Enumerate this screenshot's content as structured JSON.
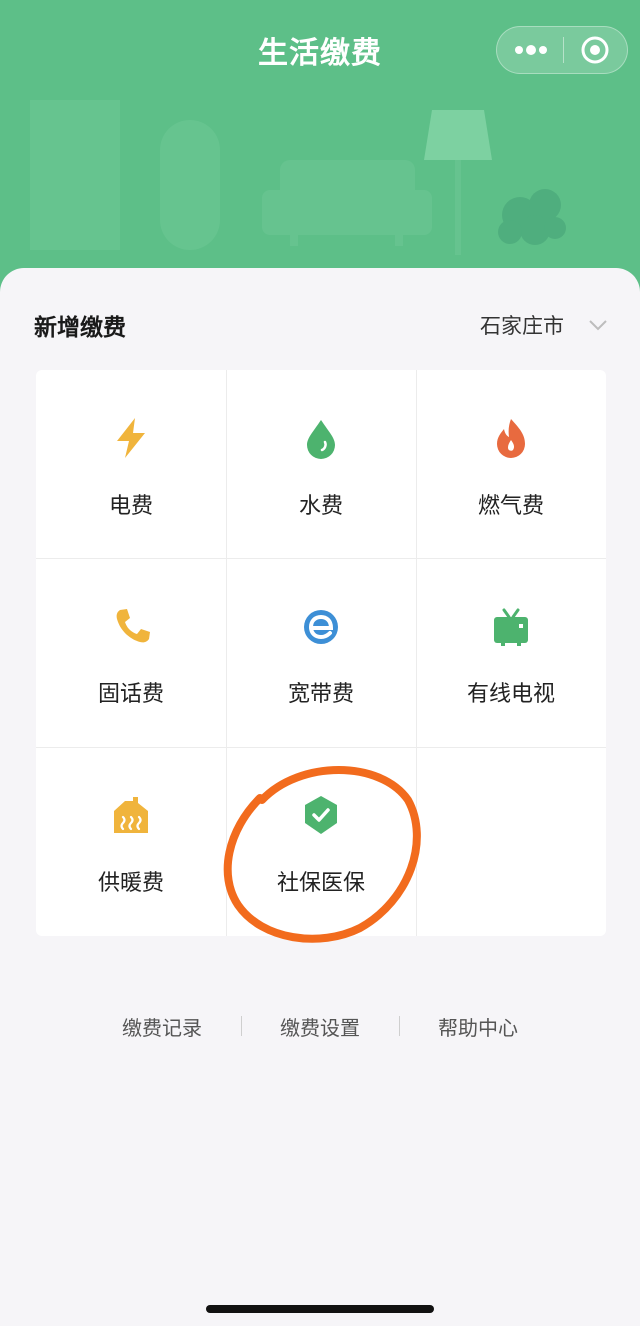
{
  "header": {
    "title": "生活缴费",
    "more_icon": "more-dots-icon",
    "close_icon": "target-circle-icon",
    "color": "#5dbf88"
  },
  "section": {
    "title": "新增缴费",
    "city": "石家庄市",
    "city_icon": "chevron-down-icon"
  },
  "services": [
    {
      "label": "电费",
      "icon": "lightning-icon",
      "color": "#f0b43c"
    },
    {
      "label": "水费",
      "icon": "water-drop-icon",
      "color": "#4db36e"
    },
    {
      "label": "燃气费",
      "icon": "flame-icon",
      "color": "#e86a3f"
    },
    {
      "label": "固话费",
      "icon": "phone-icon",
      "color": "#f0b43c"
    },
    {
      "label": "宽带费",
      "icon": "broadband-e-icon",
      "color": "#3d8fd6"
    },
    {
      "label": "有线电视",
      "icon": "tv-icon",
      "color": "#4db36e"
    },
    {
      "label": "供暖费",
      "icon": "heating-house-icon",
      "color": "#f0b43c"
    },
    {
      "label": "社保医保",
      "icon": "shield-check-icon",
      "color": "#4db36e"
    }
  ],
  "footer_links": [
    "缴费记录",
    "缴费设置",
    "帮助中心"
  ],
  "annotation_color": "#f26b1d"
}
